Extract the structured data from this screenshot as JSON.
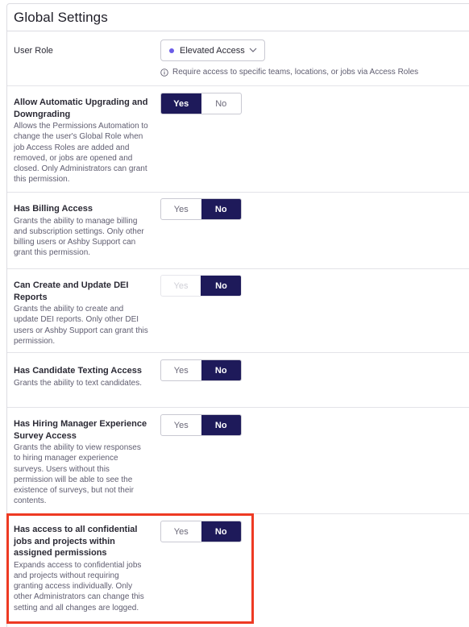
{
  "header": {
    "title": "Global Settings"
  },
  "user_role": {
    "label": "User Role",
    "value": "Elevated Access",
    "dot_color": "#6b5ce7",
    "hint": "Require access to specific teams, locations, or jobs via Access Roles"
  },
  "toggle_labels": {
    "yes": "Yes",
    "no": "No"
  },
  "colors": {
    "active": "#1e1a5a",
    "highlight": "#ee3a23"
  },
  "settings": [
    {
      "title": "Allow Automatic Upgrading and Downgrading",
      "description": "Allows the Permissions Automation to change the user's Global Role when job Access Roles are added and removed, or jobs are opened and closed. Only Administrators can grant this permission.",
      "selected": "Yes"
    },
    {
      "title": "Has Billing Access",
      "description": "Grants the ability to manage billing and subscription settings. Only other billing users or Ashby Support can grant this permission.",
      "selected": "No"
    },
    {
      "title": "Can Create and Update DEI Reports",
      "description": "Grants the ability to create and update DEI reports. Only other DEI users or Ashby Support can grant this permission.",
      "selected": "No",
      "disabled": true
    },
    {
      "title": "Has Candidate Texting Access",
      "description": "Grants the ability to text candidates.",
      "selected": "No"
    },
    {
      "title": "Has Hiring Manager Experience Survey Access",
      "description": "Grants the ability to view responses to hiring manager experience surveys. Users without this permission will be able to see the existence of surveys, but not their contents.",
      "selected": "No"
    },
    {
      "title": "Has access to all confidential jobs and projects within assigned permissions",
      "description": "Expands access to confidential jobs and projects without requiring granting access individually. Only other Administrators can change this setting and all changes are logged.",
      "selected": "No"
    }
  ]
}
